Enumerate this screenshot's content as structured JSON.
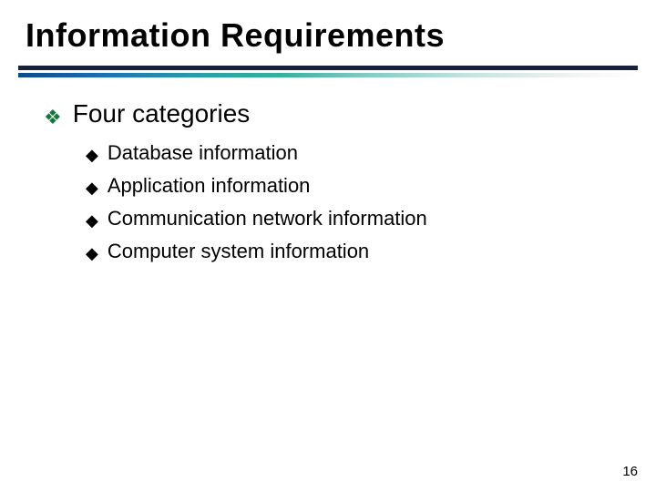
{
  "title": "Information Requirements",
  "level1": {
    "text": "Four categories"
  },
  "level2": [
    {
      "text": "Database information"
    },
    {
      "text": "Application information"
    },
    {
      "text": "Communication network information"
    },
    {
      "text": "Computer system information"
    }
  ],
  "bullets": {
    "l1": "❖",
    "l2": "◆"
  },
  "pageNumber": "16"
}
